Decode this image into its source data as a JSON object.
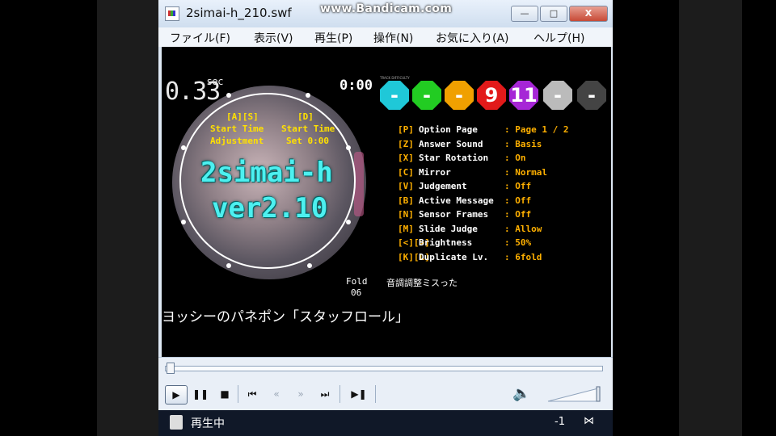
{
  "window": {
    "title": "2simai-h_210.swf",
    "watermark": "www.Bandicam.com",
    "min_label": "—",
    "max_label": "□",
    "close_label": "X"
  },
  "menu": [
    {
      "label": "ファイル(F)"
    },
    {
      "label": "表示(V)"
    },
    {
      "label": "再生(P)"
    },
    {
      "label": "操作(N)"
    },
    {
      "label": "お気に入り(A)"
    },
    {
      "label": "ヘルプ(H)"
    }
  ],
  "game": {
    "timer": "0.33",
    "timer_unit": "sec",
    "time_top": "0:00",
    "hud_as": "[A][S]",
    "hud_d": "[D]",
    "start_time_1": "Start Time",
    "start_time_2": "Start Time",
    "adjustment": "Adjustment",
    "set": "Set 0:00",
    "version_line1": "2simai-h",
    "version_line2": "ver2.10",
    "song_title": "ヨッシーのパネポン「スタッフロール」",
    "fold_label": "Fold",
    "fold_value": "06",
    "adjust_text": "音調調整ミスった",
    "difficulties": [
      {
        "value": "-",
        "color": "#1fc8d8"
      },
      {
        "value": "-",
        "color": "#22cc22"
      },
      {
        "value": "-",
        "color": "#f0a000"
      },
      {
        "value": "9",
        "color": "#e21a1a"
      },
      {
        "value": "11",
        "color": "#a626d6"
      },
      {
        "value": "-",
        "color": "#bbbbbb"
      },
      {
        "value": "-",
        "color": "#444444"
      }
    ],
    "options": [
      {
        "key": "[P]",
        "name": "Option Page",
        "value": ": Page 1 / 2"
      },
      {
        "key": "[Z]",
        "name": "Answer Sound",
        "value": ": Basis"
      },
      {
        "key": "[X]",
        "name": "Star Rotation",
        "value": ": On"
      },
      {
        "key": "[C]",
        "name": "Mirror",
        "value": ": Normal"
      },
      {
        "key": "[V]",
        "name": "Judgement",
        "value": ": Off"
      },
      {
        "key": "[B]",
        "name": "Active Message",
        "value": ": Off"
      },
      {
        "key": "[N]",
        "name": "Sensor Frames",
        "value": ": Off"
      },
      {
        "key": "[M]",
        "name": "Slide Judge",
        "value": ": Allow"
      },
      {
        "key": "[<][>]",
        "name": "Brightness",
        "value": ": 50%"
      },
      {
        "key": "[K][L]",
        "name": "Duplicate Lv.",
        "value": ": 6fold"
      }
    ]
  },
  "player": {
    "buttons": [
      "▶",
      "❚❚",
      "■",
      "⏮",
      "«",
      "»",
      "⏭",
      "▶❚"
    ],
    "volume_icon": "🔈"
  },
  "status": {
    "text": "再生中",
    "number": "-1",
    "icon": "⋈"
  }
}
